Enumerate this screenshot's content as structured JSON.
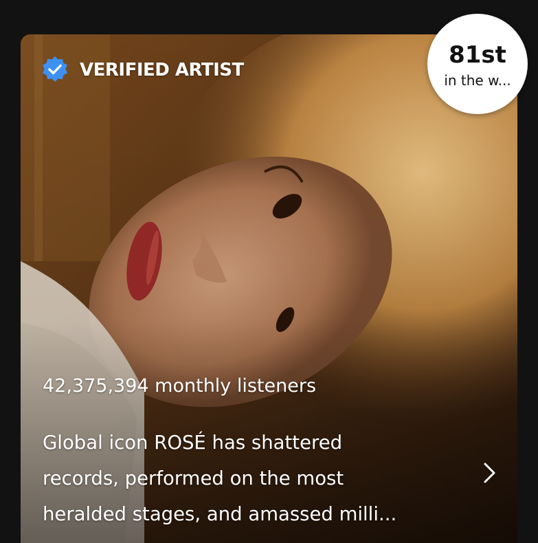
{
  "artist": {
    "verified_label": "VERIFIED ARTIST",
    "monthly_listeners": "42,375,394 monthly listeners",
    "bio_lines": [
      "Global icon ROSÉ has shattered",
      "records, performed on the most",
      "heralded stages, and amassed milli..."
    ]
  },
  "rank": {
    "value": "81st",
    "subtitle": "in the w..."
  },
  "icons": {
    "verified": "verified-badge-icon",
    "chevron": "chevron-right-icon"
  },
  "colors": {
    "background": "#121212",
    "verified_blue": "#3D91F4",
    "text": "#FFFFFF",
    "badge_bg": "#FFFFFF"
  }
}
